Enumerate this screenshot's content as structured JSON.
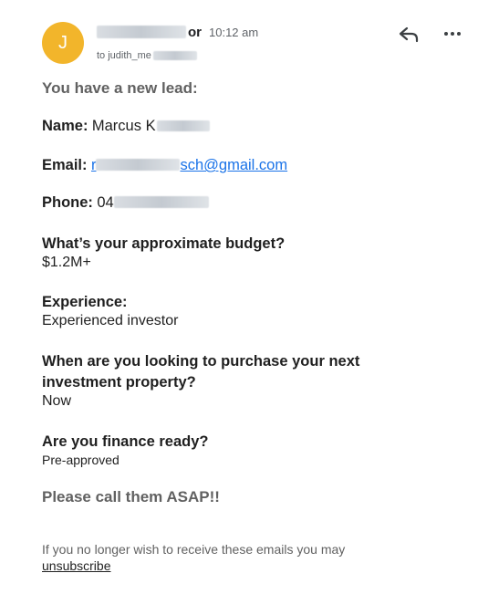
{
  "header": {
    "avatar_letter": "J",
    "avatar_color": "#f2b52b",
    "sender_visible_tail": "or",
    "time": "10:12 am",
    "to_prefix": "to judith_me"
  },
  "icons": {
    "reply": "reply-icon",
    "more": "more-options-icon"
  },
  "email": {
    "intro": "You have a new lead:",
    "name_label": "Name:",
    "name_value": "Marcus K",
    "email_label": "Email:",
    "email_prefix": "r",
    "email_suffix": "sch@gmail.com",
    "phone_label": "Phone:",
    "phone_value": "04",
    "budget_question": "What’s your approximate budget?",
    "budget_answer": "$1.2M+",
    "experience_question": "Experience:",
    "experience_answer": "Experienced investor",
    "purchase_question_line1": "When are you looking to purchase your next",
    "purchase_question_line2": "investment property?",
    "purchase_answer": "Now",
    "finance_question": "Are you finance ready?",
    "finance_answer": "Pre-approved",
    "closing": "Please call them ASAP!!",
    "footer_text": "If you no longer wish to receive these emails you may",
    "unsubscribe": "unsubscribe"
  },
  "colors": {
    "link": "#1a73e8",
    "muted": "#616161",
    "text": "#1f1f1f"
  }
}
